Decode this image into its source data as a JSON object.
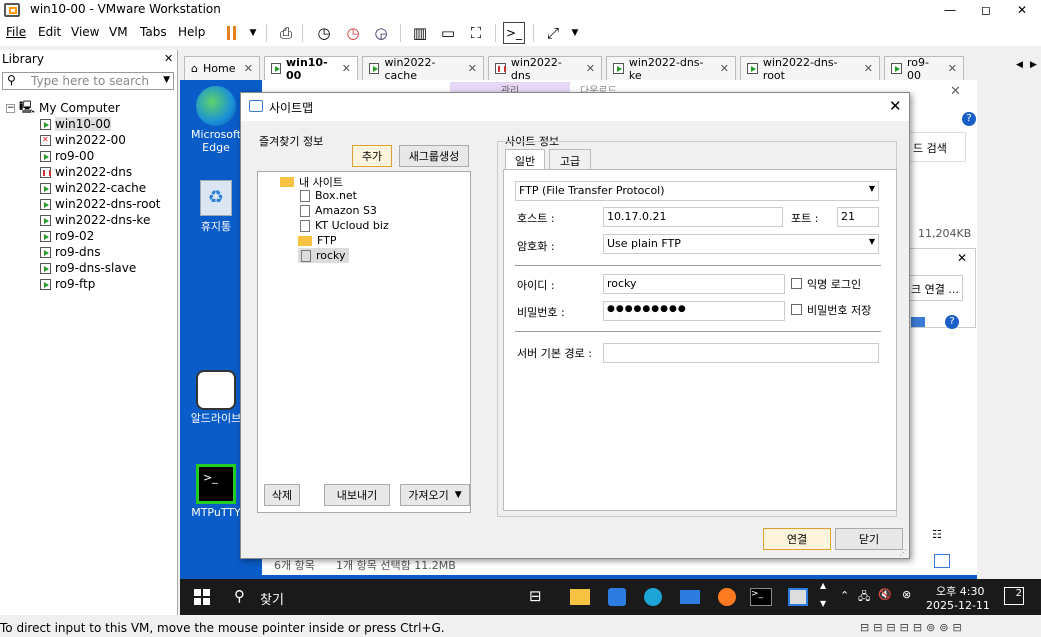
{
  "window": {
    "title": "win10-00 - VMware Workstation",
    "min": "—",
    "max": "◻",
    "close": "✕"
  },
  "menu": [
    "File",
    "Edit",
    "View",
    "VM",
    "Tabs",
    "Help"
  ],
  "library": {
    "title": "Library",
    "search_placeholder": "Type here to search",
    "root": "My Computer",
    "items": [
      "win10-00",
      "win2022-00",
      "ro9-00",
      "win2022-dns",
      "win2022-cache",
      "win2022-dns-root",
      "win2022-dns-ke",
      "ro9-02",
      "ro9-dns",
      "ro9-dns-slave",
      "ro9-ftp"
    ]
  },
  "tabs": [
    "Home",
    "win10-00",
    "win2022-cache",
    "win2022-dns",
    "win2022-dns-ke",
    "win2022-dns-root",
    "ro9-00"
  ],
  "desktop": {
    "icons": [
      "Microsoft Edge",
      "휴지통",
      "알드라이브",
      "MTPuTTY"
    ]
  },
  "explorer": {
    "search_btn": "드 검색",
    "size": "11,204KB",
    "conn_btn": "크 연결 ...",
    "status_items": "6개 항목",
    "status_selected": "1개 항목 선택함 11.2MB",
    "tab_fragment_1": "관리",
    "tab_fragment_2": "다운로드"
  },
  "dialog": {
    "title": "사이트맵",
    "fav_label": "즐겨찾기 정보",
    "add_btn": "추가",
    "newgroup_btn": "새그룹생성",
    "tree_root": "내 사이트",
    "tree_items": [
      "Box.net",
      "Amazon S3",
      "KT Ucloud biz",
      "FTP",
      "rocky"
    ],
    "delete_btn": "삭제",
    "export_btn": "내보내기",
    "import_btn": "가져오기",
    "site_label": "사이트 정보",
    "tab_general": "일반",
    "tab_advanced": "고급",
    "protocol": "FTP (File Transfer Protocol)",
    "host_label": "호스트 :",
    "host_value": "10.17.0.21",
    "port_label": "포트 :",
    "port_value": "21",
    "enc_label": "암호화 :",
    "enc_value": "Use plain FTP",
    "id_label": "아이디 :",
    "id_value": "rocky",
    "anon_label": "익명 로그인",
    "pw_label": "비밀번호 :",
    "pw_value": "●●●●●●●●●",
    "savepw_label": "비밀번호 저장",
    "path_label": "서버 기본 경로 :",
    "connect_btn": "연결",
    "close_btn": "닫기"
  },
  "taskbar": {
    "search": "찾기",
    "time": "오후 4:30",
    "date": "2025-12-11",
    "notif": "2"
  },
  "statusbar": {
    "text": "To direct input to this VM, move the mouse pointer inside or press Ctrl+G."
  }
}
